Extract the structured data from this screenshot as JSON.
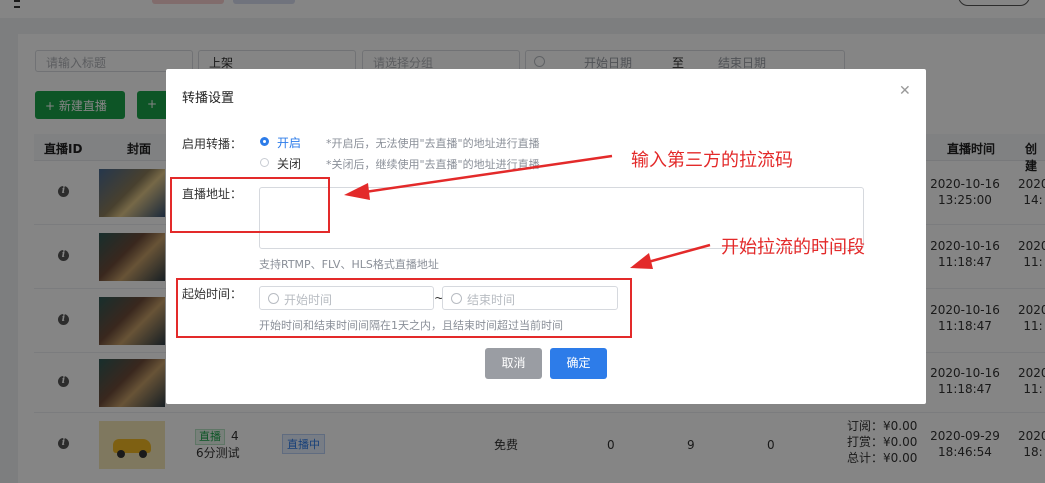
{
  "filters": {
    "title_placeholder": "请输入标题",
    "status_value": "上架",
    "group_placeholder": "请选择分组",
    "start_date_placeholder": "开始日期",
    "range_separator": "至",
    "end_date_placeholder": "结束日期"
  },
  "toolbar": {
    "new_live_label": "+ 新建直播",
    "second_button_label": "+"
  },
  "table": {
    "headers": {
      "id": "直播ID",
      "cover": "封面",
      "live_time": "直播时间",
      "created": "创建"
    },
    "rows": [
      {
        "date": "2020-10-16",
        "time": "13:25:00",
        "created_date": "2020",
        "created_time": "14:"
      },
      {
        "date": "2020-10-16",
        "time": "11:18:47",
        "created_date": "2020",
        "created_time": "11:"
      },
      {
        "date": "2020-10-16",
        "time": "11:18:47",
        "created_date": "2020",
        "created_time": "11:"
      },
      {
        "date": "2020-10-16",
        "time": "11:18:47",
        "created_date": "2020",
        "created_time": "11:"
      },
      {
        "live_tag": "直播",
        "count": "4",
        "title": "6分测试",
        "status_badge": "直播中",
        "price": "免费",
        "col_a": "0",
        "col_b": "9",
        "col_c": "0",
        "subscribe": "订阅：¥0.00",
        "reward": "打赏：¥0.00",
        "total": "总计：¥0.00",
        "date": "2020-09-29",
        "time": "18:46:54",
        "created_date": "2020",
        "created_time": "18:"
      }
    ]
  },
  "dialog": {
    "title": "转播设置",
    "close_icon": "close-icon",
    "enable_label": "启用转播：",
    "option_on": "开启",
    "option_on_hint": "*开启后，无法使用\"去直播\"的地址进行直播",
    "option_off": "关闭",
    "option_off_hint": "*关闭后，继续使用\"去直播\"的地址进行直播",
    "selected": "开启",
    "address_label": "直播地址：",
    "address_value": "",
    "address_hint": "支持RTMP、FLV、HLS格式直播地址",
    "time_label": "起始时间：",
    "start_placeholder": "开始时间",
    "range_sep": "~",
    "end_placeholder": "结束时间",
    "time_hint": "开始时间和结束时间间隔在1天之内，且结束时间超过当前时间",
    "cancel_label": "取消",
    "confirm_label": "确定"
  },
  "annotations": {
    "arrow1_text": "输入第三方的拉流码",
    "arrow2_text": "开始拉流的时间段",
    "color": "#e32a2a"
  },
  "colors": {
    "primary": "#2d7ce9",
    "green": "#1aa34a",
    "cancel_gray": "#9a9da3"
  }
}
